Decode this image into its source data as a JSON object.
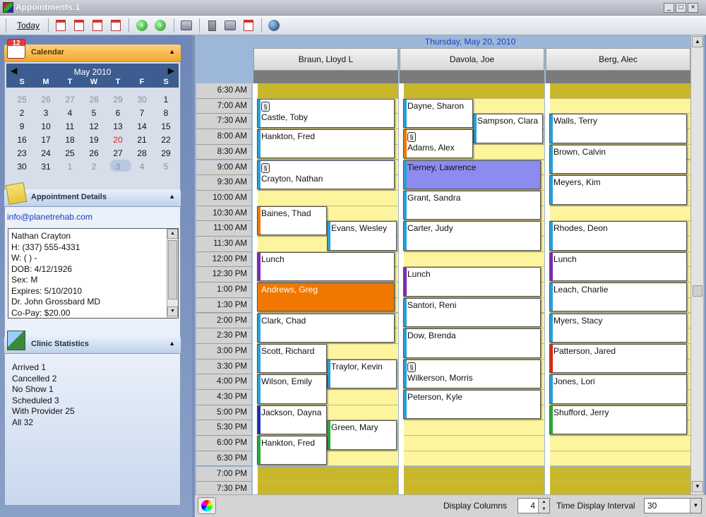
{
  "window": {
    "title": "Appointments:1",
    "minimize": "_",
    "maximize": "□",
    "close": "×"
  },
  "toolbar": {
    "today_label": "Today"
  },
  "calendar": {
    "panel_title": "Calendar",
    "icon_text": "12",
    "month": "May 2010",
    "prev": "◀",
    "next": "▶",
    "weekdays": [
      "S",
      "M",
      "T",
      "W",
      "T",
      "F",
      "S"
    ],
    "weeks": [
      [
        "25",
        "26",
        "27",
        "28",
        "29",
        "30",
        "1"
      ],
      [
        "2",
        "3",
        "4",
        "5",
        "6",
        "7",
        "8"
      ],
      [
        "9",
        "10",
        "11",
        "12",
        "13",
        "14",
        "15"
      ],
      [
        "16",
        "17",
        "18",
        "19",
        "20",
        "21",
        "22"
      ],
      [
        "23",
        "24",
        "25",
        "26",
        "27",
        "28",
        "29"
      ],
      [
        "30",
        "31",
        "1",
        "2",
        "3",
        "4",
        "5"
      ]
    ],
    "selected_day": "20"
  },
  "appointment_details": {
    "panel_title": "Appointment Details",
    "email": "info@planetrehab.com",
    "lines": [
      "Nathan  Crayton",
      "H: (337) 555-4331",
      "W: (   )   -",
      "DOB: 4/12/1926",
      "Sex: M",
      "Expires: 5/10/2010",
      "Dr. John   Grossbard MD",
      "Co-Pay: $20.00"
    ]
  },
  "clinic_statistics": {
    "panel_title": "Clinic Statistics",
    "lines": [
      "Arrived 1",
      "Cancelled 2",
      "No Show 1",
      "Scheduled 3",
      "With Provider 25",
      "All 32"
    ]
  },
  "scheduler": {
    "date": "Thursday, May 20, 2010",
    "providers": [
      "Braun, Lloyd L",
      "Davola, Joe",
      "Berg, Alec"
    ],
    "times": [
      "6:30 AM",
      "7:00 AM",
      "7:30 AM",
      "8:00 AM",
      "8:30 AM",
      "9:00 AM",
      "9:30 AM",
      "10:00 AM",
      "10:30 AM",
      "11:00 AM",
      "11:30 AM",
      "12:00 PM",
      "12:30 PM",
      "1:00 PM",
      "1:30 PM",
      "2:00 PM",
      "2:30 PM",
      "3:00 PM",
      "3:30 PM",
      "4:00 PM",
      "4:30 PM",
      "5:00 PM",
      "5:30 PM",
      "6:00 PM",
      "6:30 PM",
      "7:00 PM",
      "7:30 PM"
    ],
    "appointments": [
      {
        "name": "Castle, Toby",
        "col": 0,
        "sub": 0,
        "span": 2,
        "start": 1,
        "len": 2,
        "tag": "#2a9fd6",
        "note": true
      },
      {
        "name": "Hankton, Fred",
        "col": 0,
        "sub": 0,
        "span": 2,
        "start": 3,
        "len": 2,
        "tag": "#2a9fd6"
      },
      {
        "name": "Crayton, Nathan",
        "col": 0,
        "sub": 0,
        "span": 2,
        "start": 5,
        "len": 2,
        "tag": "#2a9fd6",
        "note": true
      },
      {
        "name": "Baines, Thad",
        "col": 0,
        "sub": 0,
        "span": 1,
        "start": 8,
        "len": 2,
        "tag": "#f07800"
      },
      {
        "name": "Evans, Wesley",
        "col": 0,
        "sub": 1,
        "span": 1,
        "start": 9,
        "len": 2,
        "tag": "#2a9fd6"
      },
      {
        "name": "Lunch",
        "col": 0,
        "sub": 0,
        "span": 2,
        "start": 11,
        "len": 2,
        "tag": "#7a2bb5"
      },
      {
        "name": "Andrews, Greg",
        "col": 0,
        "sub": 0,
        "span": 2,
        "start": 13,
        "len": 2,
        "tag": "#f07800",
        "bg": "#f07800",
        "fg": "#ffffff"
      },
      {
        "name": "Clark, Chad",
        "col": 0,
        "sub": 0,
        "span": 2,
        "start": 15,
        "len": 2,
        "tag": "#2a9fd6"
      },
      {
        "name": "Scott, Richard",
        "col": 0,
        "sub": 0,
        "span": 1,
        "start": 17,
        "len": 2,
        "tag": "#2a9fd6"
      },
      {
        "name": "Traylor, Kevin",
        "col": 0,
        "sub": 1,
        "span": 1,
        "start": 18,
        "len": 2,
        "tag": "#2a9fd6"
      },
      {
        "name": "Wilson, Emily",
        "col": 0,
        "sub": 0,
        "span": 1,
        "start": 19,
        "len": 2,
        "tag": "#2a9fd6"
      },
      {
        "name": "Jackson, Dayna",
        "col": 0,
        "sub": 0,
        "span": 1,
        "start": 21,
        "len": 2,
        "tag": "#1a2fb5"
      },
      {
        "name": "Green, Mary",
        "col": 0,
        "sub": 1,
        "span": 1,
        "start": 22,
        "len": 2,
        "tag": "#2aa83a"
      },
      {
        "name": "Hankton, Fred",
        "col": 0,
        "sub": 0,
        "span": 1,
        "start": 23,
        "len": 2,
        "tag": "#2aa83a"
      },
      {
        "name": "Dayne, Sharon",
        "col": 1,
        "sub": 0,
        "span": 1,
        "start": 1,
        "len": 2,
        "tag": "#2a9fd6"
      },
      {
        "name": "Sampson, Clara",
        "col": 1,
        "sub": 1,
        "span": 1,
        "start": 2,
        "len": 2,
        "tag": "#2a9fd6"
      },
      {
        "name": "Adams, Alex",
        "col": 1,
        "sub": 0,
        "span": 1,
        "start": 3,
        "len": 2,
        "tag": "#f07800",
        "note": true
      },
      {
        "name": "Tierney, Lawrence",
        "col": 1,
        "sub": 0,
        "span": 2,
        "start": 5,
        "len": 2,
        "tag": "#2a9fd6",
        "bg": "#8c8cf0",
        "fg": "#111111"
      },
      {
        "name": "Grant, Sandra",
        "col": 1,
        "sub": 0,
        "span": 2,
        "start": 7,
        "len": 2,
        "tag": "#2a9fd6"
      },
      {
        "name": "Carter, Judy",
        "col": 1,
        "sub": 0,
        "span": 2,
        "start": 9,
        "len": 2,
        "tag": "#2a9fd6"
      },
      {
        "name": "Lunch",
        "col": 1,
        "sub": 0,
        "span": 2,
        "start": 12,
        "len": 2,
        "tag": "#7a2bb5"
      },
      {
        "name": "Santori, Reni",
        "col": 1,
        "sub": 0,
        "span": 2,
        "start": 14,
        "len": 2,
        "tag": "#2a9fd6"
      },
      {
        "name": "Dow, Brenda",
        "col": 1,
        "sub": 0,
        "span": 2,
        "start": 16,
        "len": 2,
        "tag": "#2a9fd6"
      },
      {
        "name": "Wilkerson, Morris",
        "col": 1,
        "sub": 0,
        "span": 2,
        "start": 18,
        "len": 2,
        "tag": "#2a9fd6",
        "note": true
      },
      {
        "name": "Peterson, Kyle",
        "col": 1,
        "sub": 0,
        "span": 2,
        "start": 20,
        "len": 2,
        "tag": "#2a9fd6"
      },
      {
        "name": "Walls, Terry",
        "col": 2,
        "sub": 0,
        "span": 2,
        "start": 2,
        "len": 2,
        "tag": "#2a9fd6"
      },
      {
        "name": "Brown, Calvin",
        "col": 2,
        "sub": 0,
        "span": 2,
        "start": 4,
        "len": 2,
        "tag": "#2a9fd6"
      },
      {
        "name": "Meyers, Kim",
        "col": 2,
        "sub": 0,
        "span": 2,
        "start": 6,
        "len": 2,
        "tag": "#2a9fd6"
      },
      {
        "name": "Rhodes, Deon",
        "col": 2,
        "sub": 0,
        "span": 2,
        "start": 9,
        "len": 2,
        "tag": "#2a9fd6"
      },
      {
        "name": "Lunch",
        "col": 2,
        "sub": 0,
        "span": 2,
        "start": 11,
        "len": 2,
        "tag": "#7a2bb5"
      },
      {
        "name": "Leach, Charlie",
        "col": 2,
        "sub": 0,
        "span": 2,
        "start": 13,
        "len": 2,
        "tag": "#2a9fd6"
      },
      {
        "name": "Myers, Stacy",
        "col": 2,
        "sub": 0,
        "span": 2,
        "start": 15,
        "len": 2,
        "tag": "#2a9fd6"
      },
      {
        "name": "Patterson, Jared",
        "col": 2,
        "sub": 0,
        "span": 2,
        "start": 17,
        "len": 2,
        "tag": "#d62a1a"
      },
      {
        "name": "Jones, Lori",
        "col": 2,
        "sub": 0,
        "span": 2,
        "start": 19,
        "len": 2,
        "tag": "#2a9fd6"
      },
      {
        "name": "Shufford, Jerry",
        "col": 2,
        "sub": 0,
        "span": 2,
        "start": 21,
        "len": 2,
        "tag": "#2aa83a"
      }
    ]
  },
  "footer": {
    "display_columns_label": "Display Columns",
    "display_columns_value": "4",
    "time_interval_label": "Time Display Interval",
    "time_interval_value": "30"
  },
  "colors": {
    "accent": "#f1a630",
    "open_slot": "#fcf59e",
    "closed_slot": "#c8b72a",
    "date_text": "#1f3fbf"
  }
}
